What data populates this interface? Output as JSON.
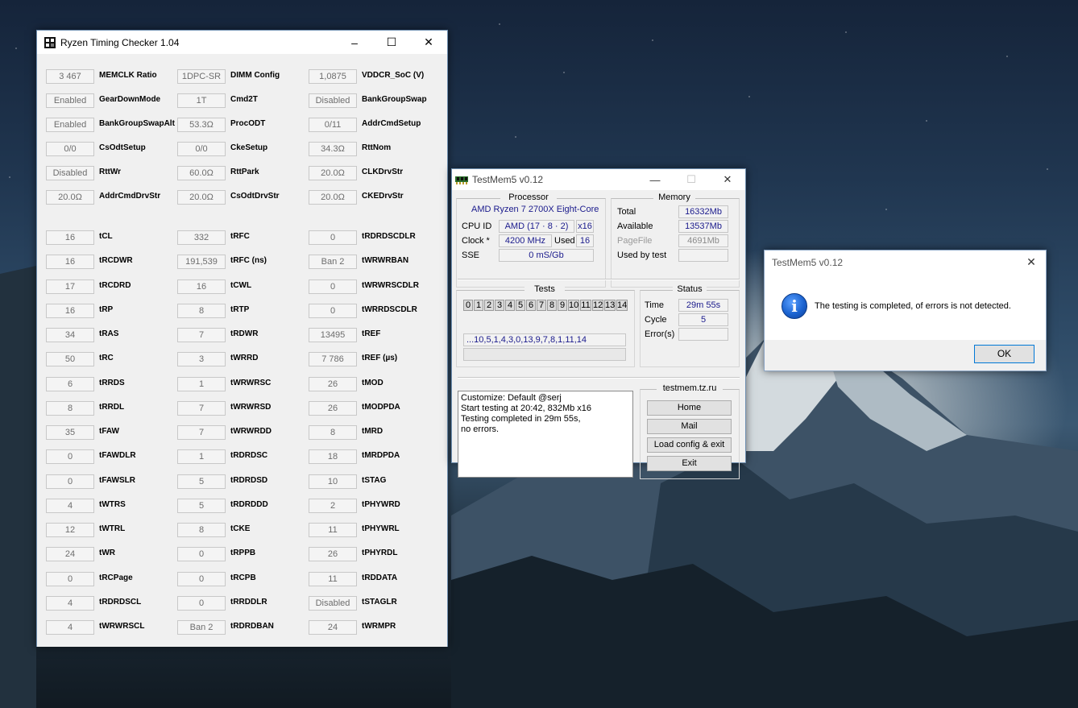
{
  "rtc": {
    "title": "Ryzen Timing Checker 1.04",
    "minimize": "–",
    "maximize": "☐",
    "close": "✕",
    "columns": [
      [
        {
          "value": "3 467",
          "label": "MEMCLK Ratio"
        },
        {
          "value": "Enabled",
          "label": "GearDownMode"
        },
        {
          "value": "Enabled",
          "label": "BankGroupSwapAlt"
        },
        {
          "value": "0/0",
          "label": "CsOdtSetup"
        },
        {
          "value": "Disabled",
          "label": "RttWr"
        },
        {
          "value": "20.0Ω",
          "label": "AddrCmdDrvStr"
        },
        {
          "value": "16",
          "label": "tCL"
        },
        {
          "value": "16",
          "label": "tRCDWR"
        },
        {
          "value": "17",
          "label": "tRCDRD"
        },
        {
          "value": "16",
          "label": "tRP"
        },
        {
          "value": "34",
          "label": "tRAS"
        },
        {
          "value": "50",
          "label": "tRC"
        },
        {
          "value": "6",
          "label": "tRRDS"
        },
        {
          "value": "8",
          "label": "tRRDL"
        },
        {
          "value": "35",
          "label": "tFAW"
        },
        {
          "value": "0",
          "label": "tFAWDLR"
        },
        {
          "value": "0",
          "label": "tFAWSLR"
        },
        {
          "value": "4",
          "label": "tWTRS"
        },
        {
          "value": "12",
          "label": "tWTRL"
        },
        {
          "value": "24",
          "label": "tWR"
        },
        {
          "value": "0",
          "label": "tRCPage"
        },
        {
          "value": "4",
          "label": "tRDRDSCL"
        },
        {
          "value": "4",
          "label": "tWRWRSCL"
        }
      ],
      [
        {
          "value": "1DPC-SR",
          "label": "DIMM Config"
        },
        {
          "value": "1T",
          "label": "Cmd2T"
        },
        {
          "value": "53.3Ω",
          "label": "ProcODT"
        },
        {
          "value": "0/0",
          "label": "CkeSetup"
        },
        {
          "value": "60.0Ω",
          "label": "RttPark"
        },
        {
          "value": "20.0Ω",
          "label": "CsOdtDrvStr"
        },
        {
          "value": "332",
          "label": "tRFC"
        },
        {
          "value": "191,539",
          "label": "tRFC (ns)"
        },
        {
          "value": "16",
          "label": "tCWL"
        },
        {
          "value": "8",
          "label": "tRTP"
        },
        {
          "value": "7",
          "label": "tRDWR"
        },
        {
          "value": "3",
          "label": "tWRRD"
        },
        {
          "value": "1",
          "label": "tWRWRSC"
        },
        {
          "value": "7",
          "label": "tWRWRSD"
        },
        {
          "value": "7",
          "label": "tWRWRDD"
        },
        {
          "value": "1",
          "label": "tRDRDSC"
        },
        {
          "value": "5",
          "label": "tRDRDSD"
        },
        {
          "value": "5",
          "label": "tRDRDDD"
        },
        {
          "value": "8",
          "label": "tCKE"
        },
        {
          "value": "0",
          "label": "tRPPB"
        },
        {
          "value": "0",
          "label": "tRCPB"
        },
        {
          "value": "0",
          "label": "tRRDDLR"
        },
        {
          "value": "Ban 2",
          "label": "tRDRDBAN"
        }
      ],
      [
        {
          "value": "1,0875",
          "label": "VDDCR_SoC (V)"
        },
        {
          "value": "Disabled",
          "label": "BankGroupSwap"
        },
        {
          "value": "0/11",
          "label": "AddrCmdSetup"
        },
        {
          "value": "34.3Ω",
          "label": "RttNom"
        },
        {
          "value": "20.0Ω",
          "label": "CLKDrvStr"
        },
        {
          "value": "20.0Ω",
          "label": "CKEDrvStr"
        },
        {
          "value": "0",
          "label": "tRDRDSCDLR"
        },
        {
          "value": "Ban 2",
          "label": "tWRWRBAN"
        },
        {
          "value": "0",
          "label": "tWRWRSCDLR"
        },
        {
          "value": "0",
          "label": "tWRRDSCDLR"
        },
        {
          "value": "13495",
          "label": "tREF"
        },
        {
          "value": "7 786",
          "label": "tREF (µs)"
        },
        {
          "value": "26",
          "label": "tMOD"
        },
        {
          "value": "26",
          "label": "tMODPDA"
        },
        {
          "value": "8",
          "label": "tMRD"
        },
        {
          "value": "18",
          "label": "tMRDPDA"
        },
        {
          "value": "10",
          "label": "tSTAG"
        },
        {
          "value": "2",
          "label": "tPHYWRD"
        },
        {
          "value": "11",
          "label": "tPHYWRL"
        },
        {
          "value": "26",
          "label": "tPHYRDL"
        },
        {
          "value": "11",
          "label": "tRDDATA"
        },
        {
          "value": "Disabled",
          "label": "tSTAGLR"
        },
        {
          "value": "24",
          "label": "tWRMPR"
        }
      ]
    ]
  },
  "tm5": {
    "title": "TestMem5 v0.12",
    "minimize": "—",
    "maximize": "☐",
    "close": "✕",
    "processor": {
      "heading": "Processor",
      "name": "AMD Ryzen 7 2700X Eight-Core",
      "cpuid_label": "CPU ID",
      "cpuid_value": "AMD  (17 · 8 · 2)",
      "threads": "x16",
      "clock_label": "Clock *",
      "clock_value": "4200 MHz",
      "used_label": "Used",
      "used_value": "16",
      "sse_label": "SSE",
      "sse_value": "0 mS/Gb"
    },
    "memory": {
      "heading": "Memory",
      "total_label": "Total",
      "total_value": "16332Mb",
      "available_label": "Available",
      "available_value": "13537Mb",
      "pagefile_label": "PageFile",
      "pagefile_value": "4691Mb",
      "usedbytest_label": "Used by test",
      "usedbytest_value": ""
    },
    "tests": {
      "heading": "Tests",
      "numbers": [
        "0",
        "1",
        "2",
        "3",
        "4",
        "5",
        "6",
        "7",
        "8",
        "9",
        "10",
        "11",
        "12",
        "13",
        "14"
      ],
      "sequence": "...10,5,1,4,3,0,13,9,7,8,1,11,14",
      "progress": ""
    },
    "status": {
      "heading": "Status",
      "time_label": "Time",
      "time_value": "29m 55s",
      "cycle_label": "Cycle",
      "cycle_value": "5",
      "errors_label": "Error(s)",
      "errors_value": ""
    },
    "log": "Customize: Default @serj\nStart testing at 20:42, 832Mb x16\nTesting completed in 29m 55s,\nno errors.",
    "site": {
      "heading": "testmem.tz.ru",
      "home": "Home",
      "mail": "Mail",
      "load_exit": "Load config & exit",
      "exit": "Exit"
    }
  },
  "dialog": {
    "title": "TestMem5 v0.12",
    "close": "✕",
    "icon": "i",
    "message": "The testing is completed, of errors is not detected.",
    "ok": "OK"
  }
}
